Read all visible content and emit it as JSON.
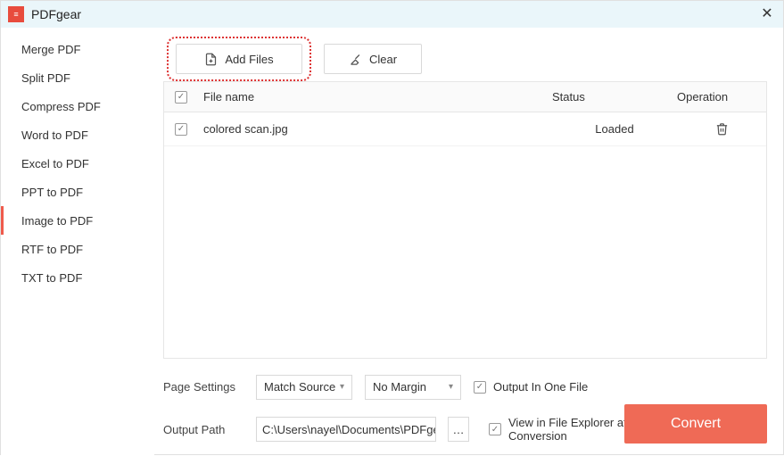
{
  "app": {
    "title": "PDFgear"
  },
  "sidebar": {
    "items": [
      {
        "label": "Merge PDF"
      },
      {
        "label": "Split PDF"
      },
      {
        "label": "Compress PDF"
      },
      {
        "label": "Word to PDF"
      },
      {
        "label": "Excel to PDF"
      },
      {
        "label": "PPT to PDF"
      },
      {
        "label": "Image to PDF"
      },
      {
        "label": "RTF to PDF"
      },
      {
        "label": "TXT to PDF"
      }
    ],
    "active_index": 6
  },
  "toolbar": {
    "add_files_label": "Add Files",
    "clear_label": "Clear"
  },
  "table": {
    "headers": {
      "filename": "File name",
      "status": "Status",
      "operation": "Operation"
    },
    "rows": [
      {
        "name": "colored scan.jpg",
        "status": "Loaded"
      }
    ]
  },
  "settings": {
    "page_settings_label": "Page Settings",
    "match_source": "Match Source",
    "no_margin": "No Margin",
    "output_one_file": "Output In One File",
    "output_path_label": "Output Path",
    "output_path": "C:\\Users\\nayel\\Documents\\PDFgear",
    "view_after": "View in File Explorer after Conversion",
    "convert_label": "Convert"
  }
}
